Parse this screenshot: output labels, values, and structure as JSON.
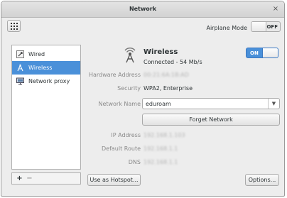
{
  "window": {
    "title": "Network",
    "close_glyph": "×"
  },
  "toolbar": {
    "airplane_label": "Airplane Mode",
    "airplane_toggle": "OFF"
  },
  "sidebar": {
    "items": [
      {
        "label": "Wired",
        "icon": "wired-icon"
      },
      {
        "label": "Wireless",
        "icon": "wireless-icon",
        "selected": true
      },
      {
        "label": "Network proxy",
        "icon": "proxy-icon"
      }
    ],
    "add_glyph": "+",
    "remove_glyph": "−"
  },
  "detail": {
    "name": "Wireless",
    "status": "Connected - 54 Mb/s",
    "toggle": "ON",
    "hardware_address_label": "Hardware Address",
    "hardware_address_value": "00:21:6A:1B:AD",
    "security_label": "Security",
    "security_value": "WPA2, Enterprise",
    "network_name_label": "Network Name",
    "network_name_value": "eduroam",
    "forget_button": "Forget Network",
    "ip_label": "IP Address",
    "ip_value": "192.168.1.103",
    "route_label": "Default Route",
    "route_value": "192.168.1.1",
    "dns_label": "DNS",
    "dns_value": "192.168.1.1"
  },
  "footer": {
    "hotspot_button": "Use as Hotspot...",
    "options_button": "Options..."
  },
  "colors": {
    "accent": "#4a90d9",
    "window_bg": "#ededed"
  }
}
